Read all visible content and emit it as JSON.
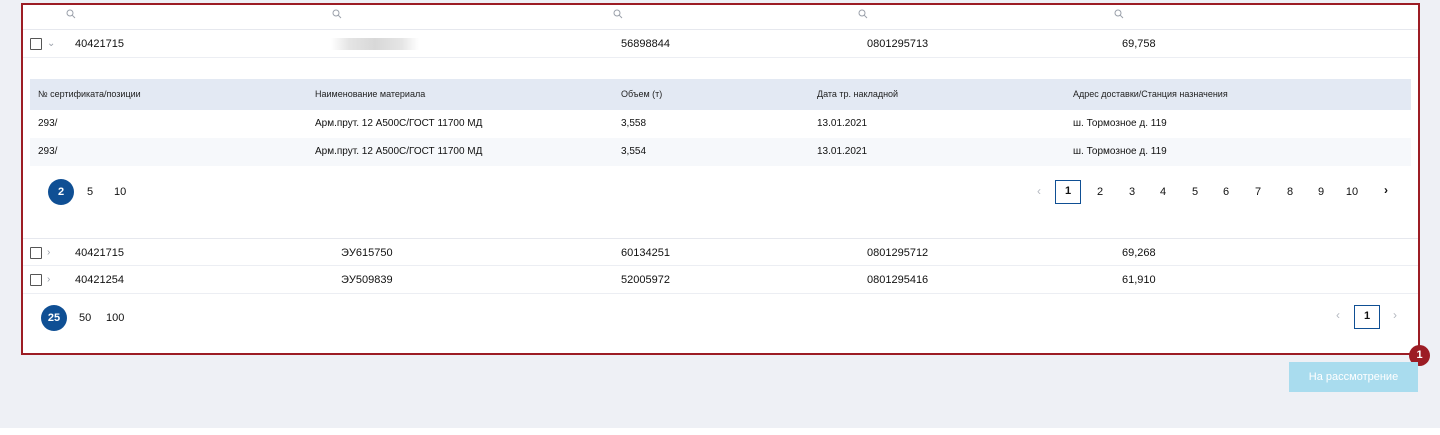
{
  "search_icons": [
    "search-icon",
    "search-icon",
    "search-icon",
    "search-icon",
    "search-icon"
  ],
  "main_rows": [
    {
      "col1": "40421715",
      "col2": "",
      "col3": "56898844",
      "col4": "0801295713",
      "col5": "69,758",
      "expanded": true
    },
    {
      "col1": "40421715",
      "col2": "ЭУ615750",
      "col3": "60134251",
      "col4": "0801295712",
      "col5": "69,268",
      "expanded": false
    },
    {
      "col1": "40421254",
      "col2": "ЭУ509839",
      "col3": "52005972",
      "col4": "0801295416",
      "col5": "61,910",
      "expanded": false
    }
  ],
  "sub_table": {
    "headers": [
      "№ сертификата/позиции",
      "Наименование материала",
      "Объем (т)",
      "Дата тр. накладной",
      "Адрес доставки/Станция назначения"
    ],
    "rows": [
      [
        "293/",
        "Арм.прут. 12 А500С/ГОСТ 11700 МД",
        "3,558",
        "13.01.2021",
        "ш. Тормозное д. 119"
      ],
      [
        "293/",
        "Арм.прут. 12 А500С/ГОСТ 11700 МД",
        "3,554",
        "13.01.2021",
        "ш. Тормозное д. 119"
      ]
    ],
    "page_size_selected": "2",
    "page_size_options": [
      "5",
      "10"
    ],
    "pages": [
      "1",
      "2",
      "3",
      "4",
      "5",
      "6",
      "7",
      "8",
      "9",
      "10"
    ],
    "current_page": "1"
  },
  "main_pagination": {
    "page_size_selected": "25",
    "page_size_options": [
      "50",
      "100"
    ],
    "current_page": "1"
  },
  "badge": "1",
  "review_button": "На рассмотрение",
  "colors": {
    "accent": "#0f4f94",
    "highlight": "#9c1c24",
    "button_disabled": "#a9dcee"
  }
}
